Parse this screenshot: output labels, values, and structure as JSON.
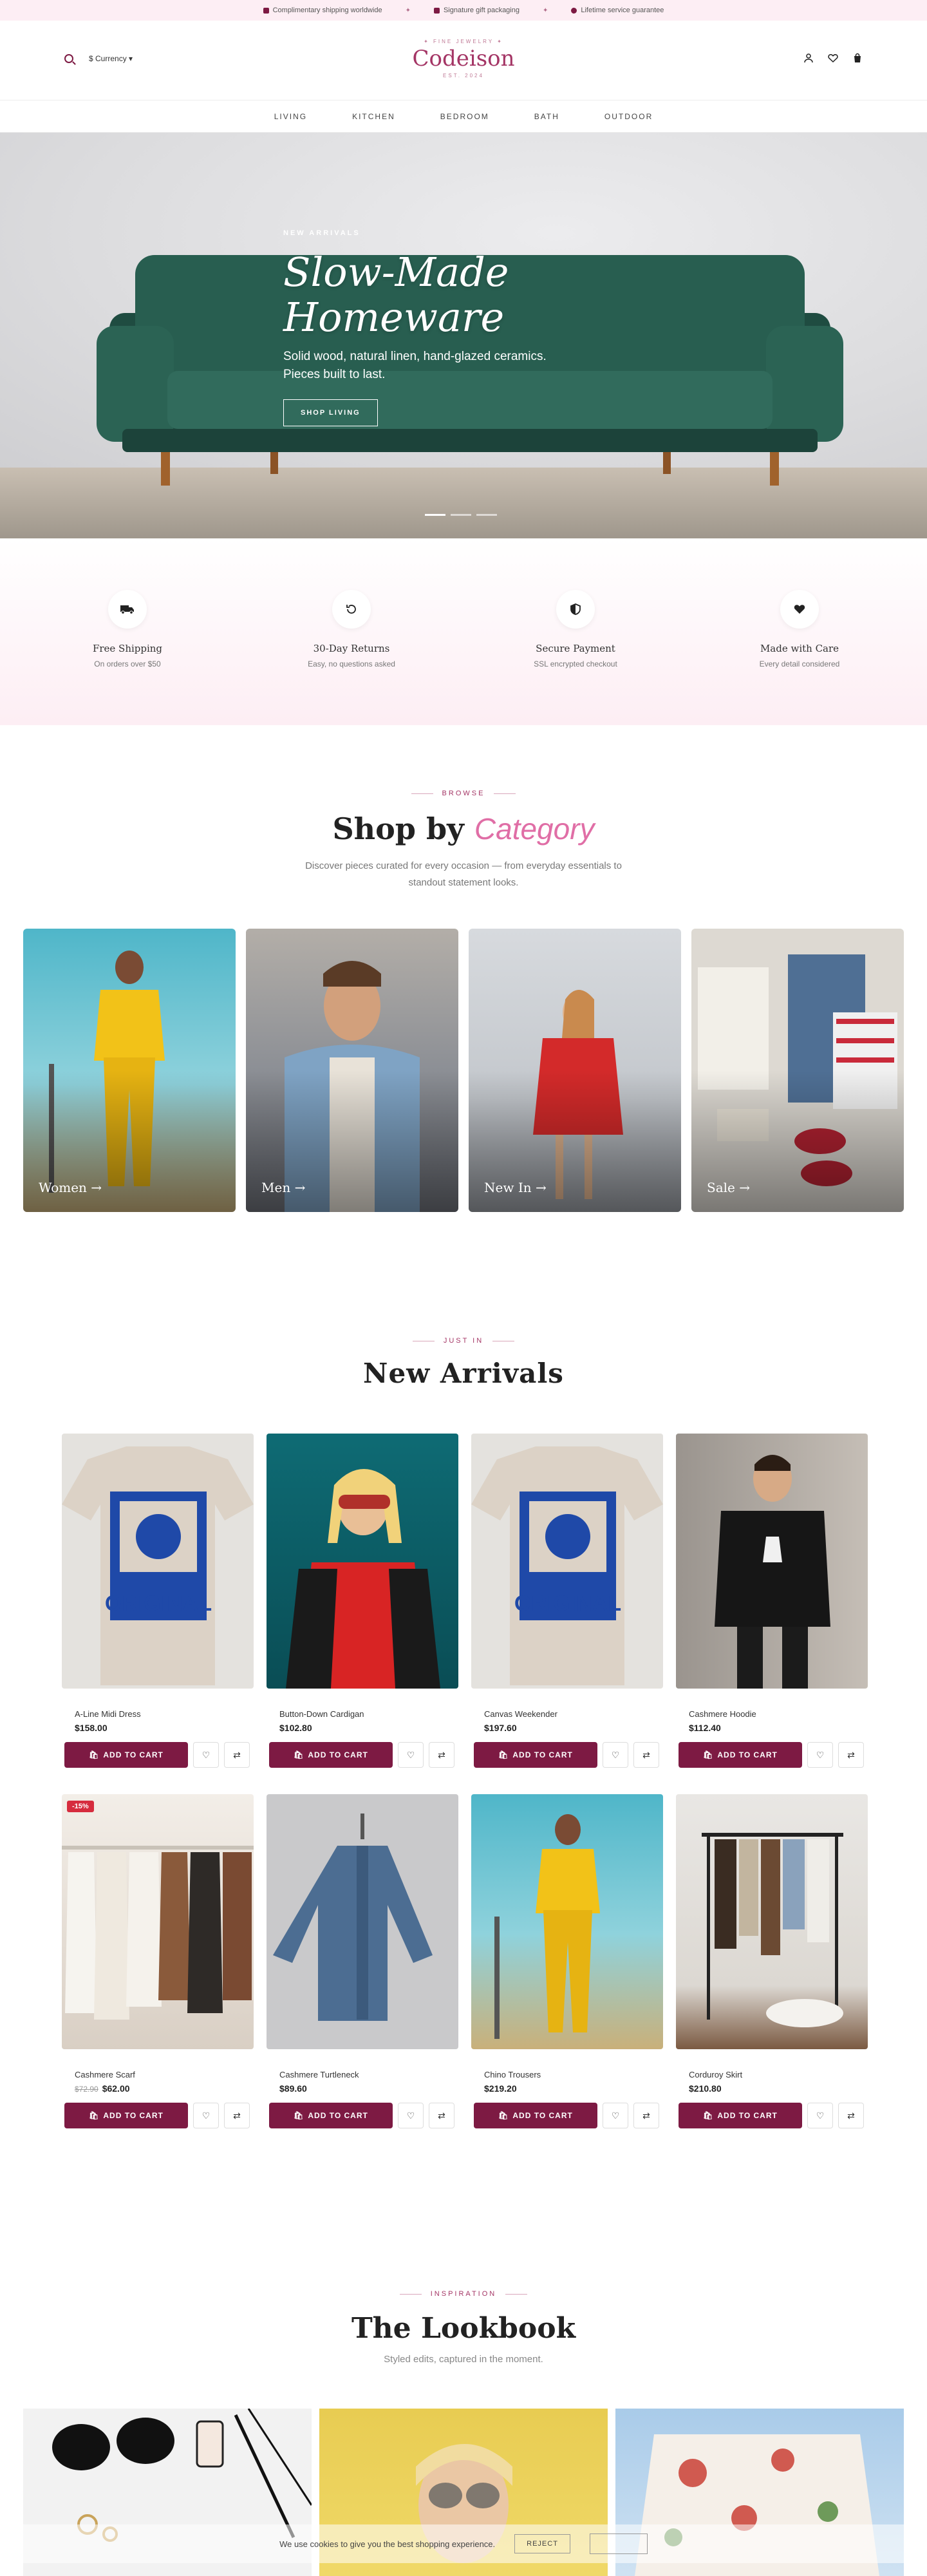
{
  "announcement": {
    "items": [
      "Complimentary shipping worldwide",
      "Signature gift packaging",
      "Lifetime service guarantee"
    ],
    "separator": "✦"
  },
  "header": {
    "currency_label": "$ Currency",
    "logo_tag": "✦ FINE JEWELRY ✦",
    "logo_name": "Codeison",
    "logo_est": "EST. 2024"
  },
  "nav": {
    "items": [
      "LIVING",
      "KITCHEN",
      "BEDROOM",
      "BATH",
      "OUTDOOR"
    ]
  },
  "hero": {
    "eyebrow": "NEW ARRIVALS",
    "title": "Slow-Made Homeware",
    "subtitle": "Solid wood, natural linen, hand-glazed ceramics. Pieces built to last.",
    "button": "SHOP LIVING",
    "slides": 3,
    "active_slide": 1
  },
  "features": [
    {
      "icon": "truck-icon",
      "title": "Free Shipping",
      "desc": "On orders over $50"
    },
    {
      "icon": "refresh-icon",
      "title": "30-Day Returns",
      "desc": "Easy, no questions asked"
    },
    {
      "icon": "shield-icon",
      "title": "Secure Payment",
      "desc": "SSL encrypted checkout"
    },
    {
      "icon": "heart-icon",
      "title": "Made with Care",
      "desc": "Every detail considered"
    }
  ],
  "browse": {
    "eyebrow": "BROWSE",
    "title_plain": "Shop by",
    "title_accent": "Category",
    "desc": "Discover pieces curated for every occasion — from everyday essentials to standout statement looks.",
    "categories": [
      "Women",
      "Men",
      "New In",
      "Sale"
    ]
  },
  "arrivals": {
    "eyebrow": "JUST IN",
    "title": "New Arrivals",
    "cart_label": "ADD TO CART",
    "products": [
      {
        "name": "A-Line Midi Dress",
        "price": "$158.00"
      },
      {
        "name": "Button-Down Cardigan",
        "price": "$102.80"
      },
      {
        "name": "Canvas Weekender",
        "price": "$197.60"
      },
      {
        "name": "Cashmere Hoodie",
        "price": "$112.40"
      },
      {
        "name": "Cashmere Scarf",
        "old_price": "$72.90",
        "price": "$62.00",
        "badge": "-15%"
      },
      {
        "name": "Cashmere Turtleneck",
        "price": "$89.60"
      },
      {
        "name": "Chino Trousers",
        "price": "$219.20"
      },
      {
        "name": "Corduroy Skirt",
        "price": "$210.80"
      }
    ]
  },
  "lookbook": {
    "eyebrow": "INSPIRATION",
    "title": "The Lookbook",
    "desc": "Styled edits, captured in the moment."
  },
  "cookie": {
    "text": "We use cookies to give you the best shopping experience.",
    "reject": "REJECT"
  },
  "colors": {
    "accent": "#7d1a43",
    "brand_pink": "#a43565",
    "highlight": "#e06ea6",
    "blush_bg": "#fdeef4"
  }
}
